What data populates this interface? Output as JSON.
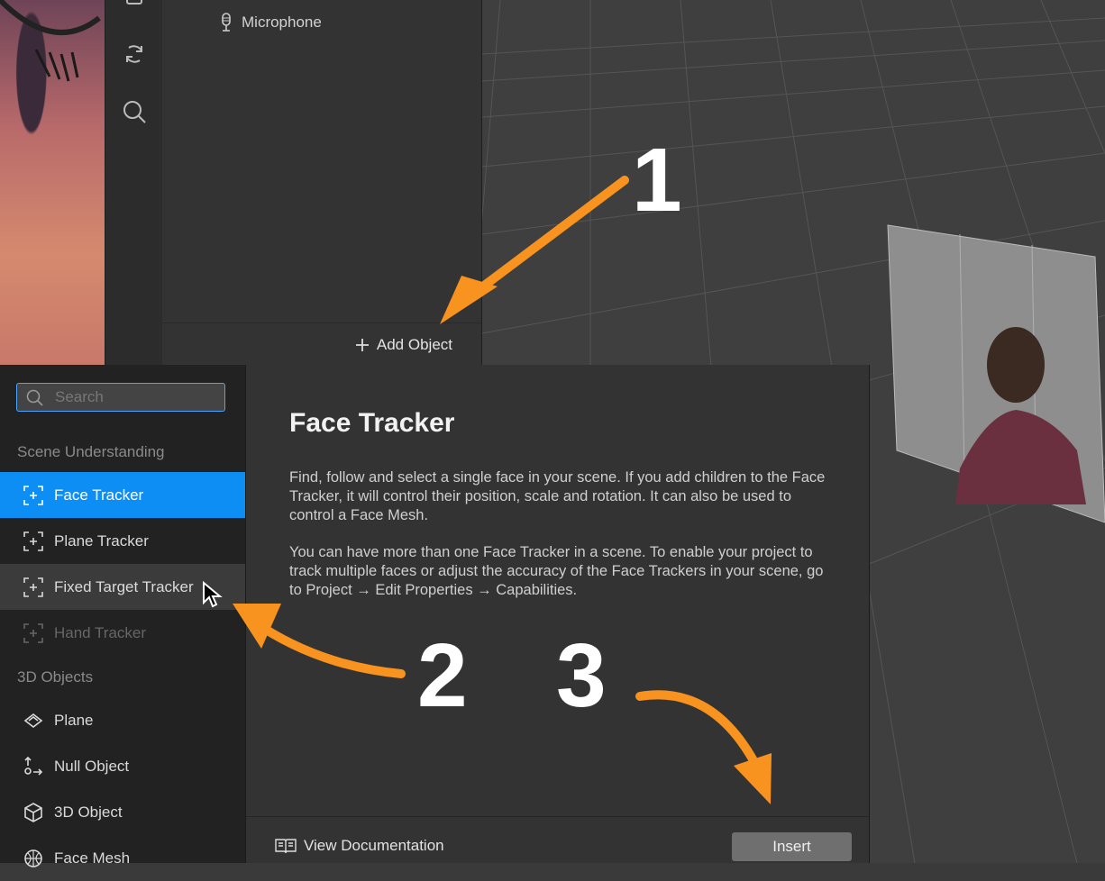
{
  "scene_panel": {
    "items": [
      {
        "label": "Microphone",
        "icon": "microphone-icon"
      }
    ],
    "add_object_label": "Add Object"
  },
  "dialog": {
    "search": {
      "placeholder": "Search",
      "value": ""
    },
    "sections": [
      {
        "heading": "Scene Understanding",
        "items": [
          {
            "label": "Face Tracker",
            "icon": "tracker-icon",
            "state": "selected"
          },
          {
            "label": "Plane Tracker",
            "icon": "tracker-icon",
            "state": "normal"
          },
          {
            "label": "Fixed Target Tracker",
            "icon": "tracker-icon",
            "state": "hovered"
          },
          {
            "label": "Hand Tracker",
            "icon": "tracker-icon",
            "state": "disabled"
          }
        ]
      },
      {
        "heading": "3D Objects",
        "items": [
          {
            "label": "Plane",
            "icon": "plane-icon",
            "state": "normal"
          },
          {
            "label": "Null Object",
            "icon": "null-object-icon",
            "state": "normal"
          },
          {
            "label": "3D Object",
            "icon": "cube-icon",
            "state": "normal"
          },
          {
            "label": "Face Mesh",
            "icon": "face-mesh-icon",
            "state": "normal"
          }
        ]
      }
    ],
    "detail": {
      "title": "Face Tracker",
      "paragraphs": [
        "Find, follow and select a single face in your scene. If you add children to the Face Tracker, it will control their position, scale and rotation. It can also be used to control a Face Mesh.",
        "You can have more than one Face Tracker in a scene. To enable your project to track multiple faces or adjust the accuracy of the Face Trackers in your scene, go to Project → Edit Properties → Capabilities."
      ]
    },
    "footer": {
      "view_docs_label": "View Documentation",
      "insert_label": "Insert"
    }
  },
  "annotations": {
    "steps": [
      "1",
      "2",
      "3"
    ],
    "arrow_color": "#F7931E"
  },
  "colors": {
    "accent": "#0D8EF5",
    "selected_text": "#FFFFFF"
  }
}
